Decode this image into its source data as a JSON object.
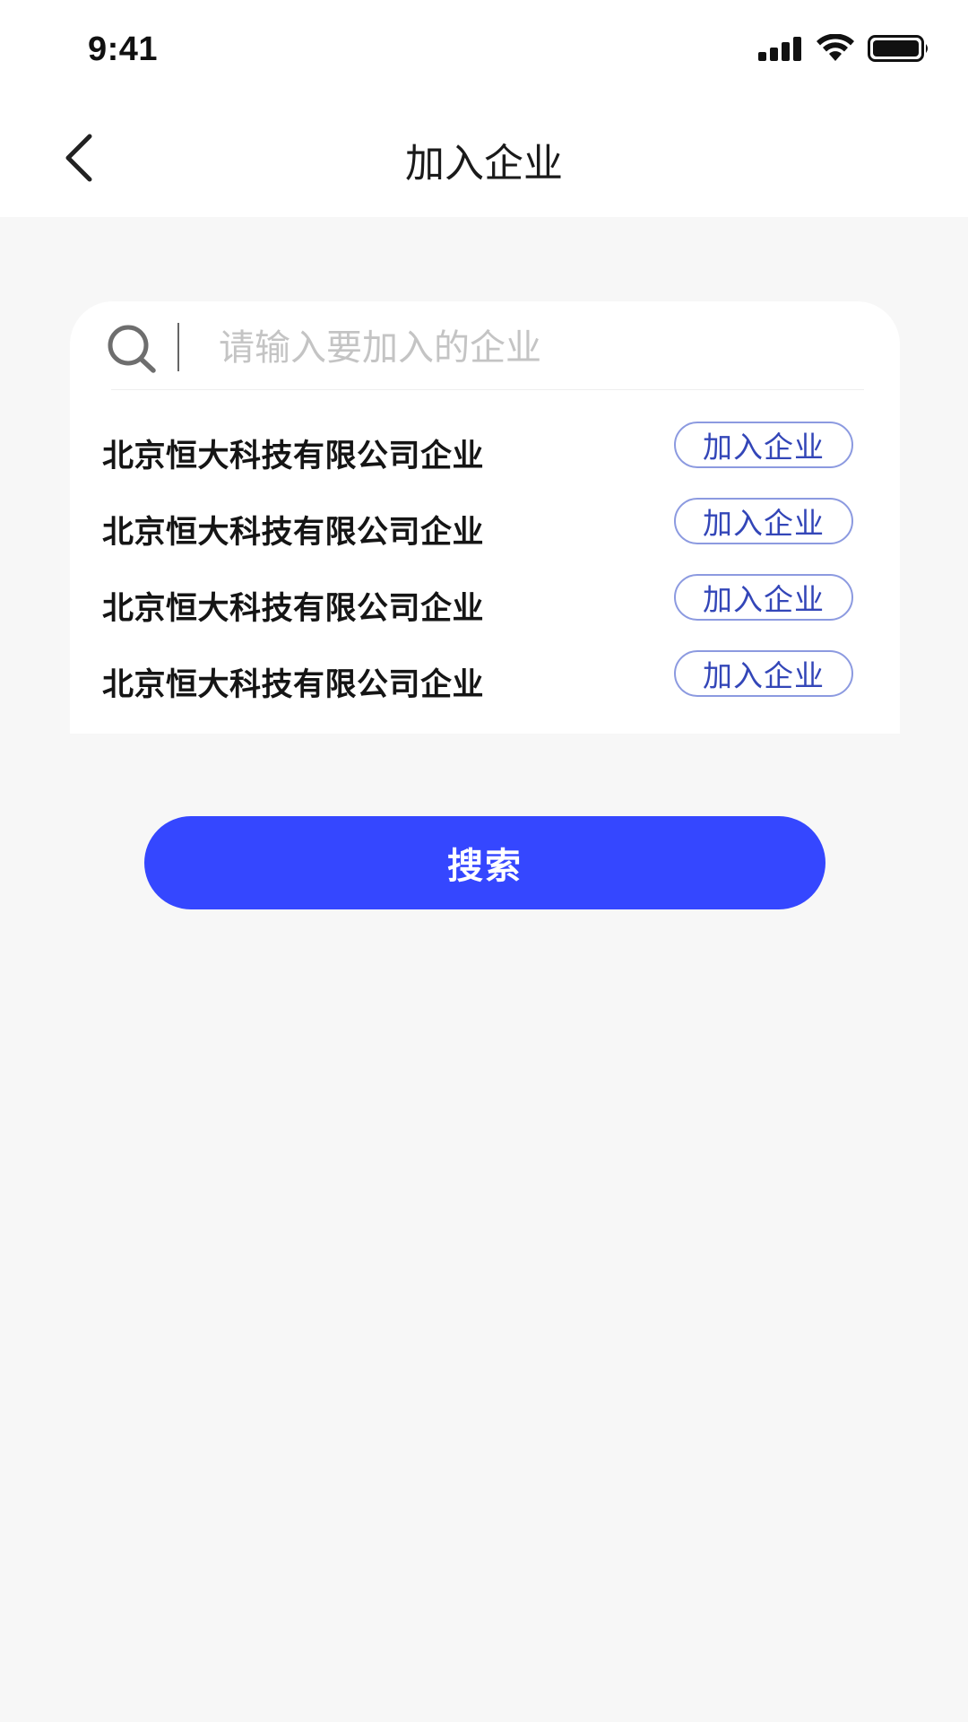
{
  "status_bar": {
    "time": "9:41",
    "icons": [
      "cellular-signal-icon",
      "wifi-icon",
      "battery-icon"
    ]
  },
  "nav": {
    "title": "加入企业",
    "back_icon": "chevron-left-icon"
  },
  "search": {
    "placeholder": "请输入要加入的企业",
    "value": "",
    "icon": "search-icon"
  },
  "companies": [
    {
      "name": "北京恒大科技有限公司企业",
      "action": "加入企业"
    },
    {
      "name": "北京恒大科技有限公司企业",
      "action": "加入企业"
    },
    {
      "name": "北京恒大科技有限公司企业",
      "action": "加入企业"
    },
    {
      "name": "北京恒大科技有限公司企业",
      "action": "加入企业"
    }
  ],
  "primary_button": {
    "label": "搜索"
  },
  "colors": {
    "accent": "#3547ff",
    "join_border": "#8c9ae0",
    "join_text": "#3346b8",
    "background": "#f7f7f7"
  }
}
